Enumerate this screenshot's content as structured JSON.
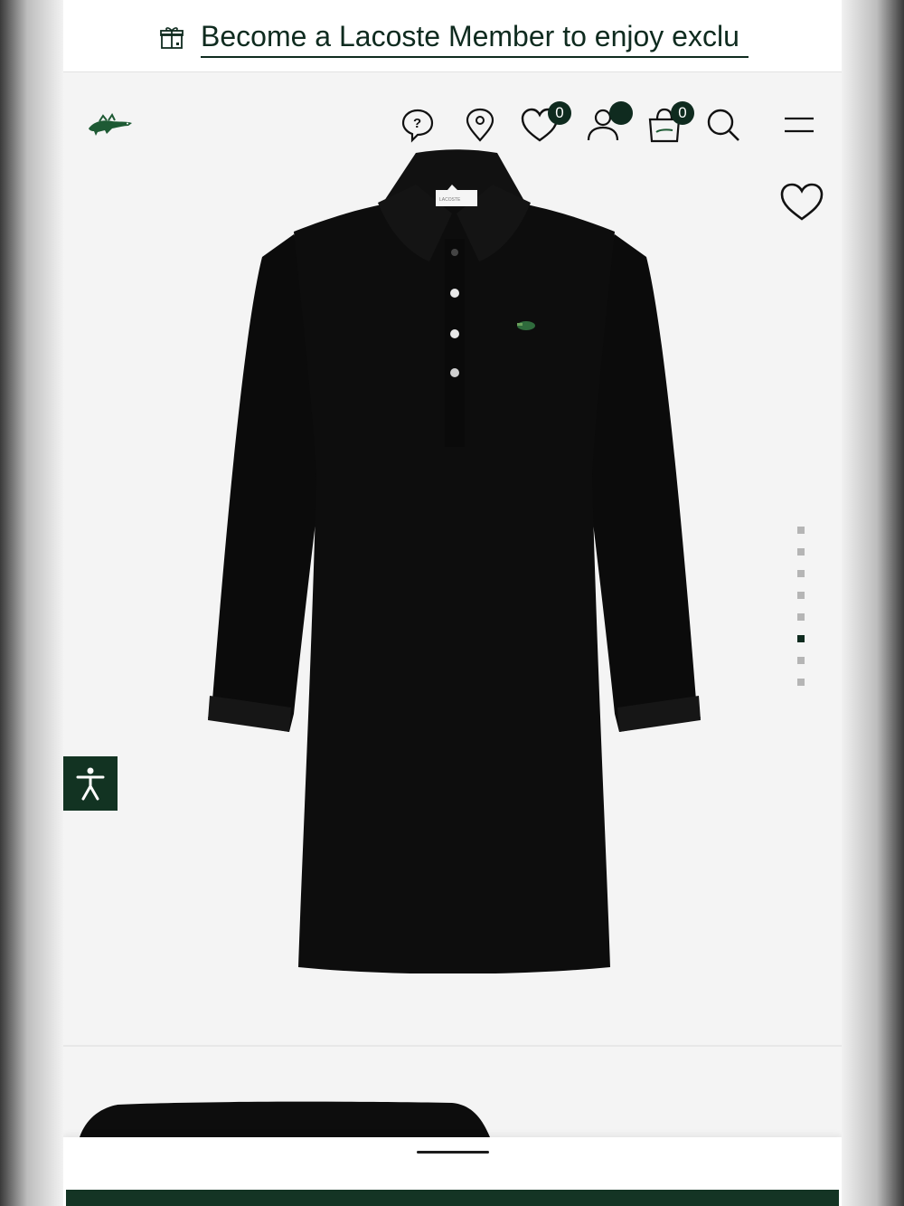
{
  "promo": {
    "text": "Become a Lacoste Member to enjoy exclu",
    "icon": "gift-icon"
  },
  "header": {
    "logo": "lacoste-crocodile-logo",
    "icons": [
      "help-icon",
      "store-locator-icon",
      "wishlist-icon",
      "account-icon",
      "cart-icon",
      "search-icon",
      "menu-icon"
    ],
    "wishlist_count": "0",
    "cart_count": "0"
  },
  "product": {
    "dots_count": 8,
    "active_dot": 6
  },
  "colors": {
    "brand_green": "#0f2b1f",
    "background": "#f4f4f4"
  }
}
